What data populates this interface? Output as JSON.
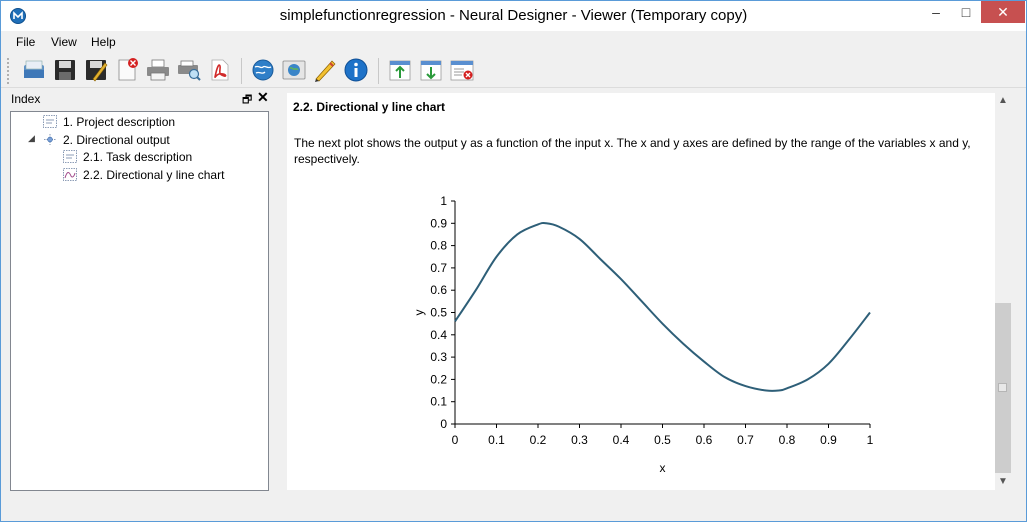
{
  "window": {
    "title": "simplefunctionregression - Neural Designer - Viewer (Temporary copy)",
    "controls": [
      "–",
      "□",
      "✕"
    ]
  },
  "menu": [
    "File",
    "View",
    "Help"
  ],
  "toolbar": {
    "buttons": [
      "open-icon",
      "save-icon",
      "save-as-icon",
      "close-file-icon",
      "print-icon",
      "print-preview-icon",
      "export-pdf-icon",
      "web-icon",
      "globe-icon",
      "edit-icon",
      "info-icon",
      "move-up-icon",
      "move-down-icon",
      "remove-task-icon"
    ]
  },
  "index": {
    "title": "Index",
    "float_glyph": "🗗",
    "close_glyph": "✕",
    "items": [
      {
        "label": "1. Project description",
        "level": 0,
        "expander": ""
      },
      {
        "label": "2. Directional output",
        "level": 0,
        "expander": "◢"
      },
      {
        "label": "2.1. Task description",
        "level": 1,
        "expander": ""
      },
      {
        "label": "2.2. Directional y line chart",
        "level": 1,
        "expander": ""
      }
    ]
  },
  "content": {
    "section_title": "2.2. Directional y line chart",
    "paragraph": "The next plot shows the output y as a function of the input x. The x and y axes are defined by the range of the variables x and y, respectively."
  },
  "scrollbar": {
    "up": "▲",
    "down": "▼"
  },
  "chart_data": {
    "type": "line",
    "xlabel": "x",
    "ylabel": "y",
    "xlim": [
      0,
      1
    ],
    "ylim": [
      0,
      1
    ],
    "x_ticks": [
      "0",
      "0.1",
      "0.2",
      "0.3",
      "0.4",
      "0.5",
      "0.6",
      "0.7",
      "0.8",
      "0.9",
      "1"
    ],
    "y_ticks": [
      "0",
      "0.1",
      "0.2",
      "0.3",
      "0.4",
      "0.5",
      "0.6",
      "0.7",
      "0.8",
      "0.9",
      "1"
    ],
    "line_color": "#2e5f78",
    "series": [
      {
        "x": [
          0,
          0.05,
          0.1,
          0.15,
          0.2,
          0.22,
          0.25,
          0.3,
          0.35,
          0.4,
          0.45,
          0.5,
          0.55,
          0.6,
          0.65,
          0.7,
          0.75,
          0.78,
          0.8,
          0.85,
          0.9,
          0.95,
          1
        ],
        "y": [
          0.46,
          0.6,
          0.75,
          0.85,
          0.895,
          0.9,
          0.885,
          0.83,
          0.74,
          0.65,
          0.55,
          0.45,
          0.36,
          0.28,
          0.21,
          0.17,
          0.15,
          0.15,
          0.16,
          0.2,
          0.27,
          0.38,
          0.5
        ]
      }
    ]
  }
}
